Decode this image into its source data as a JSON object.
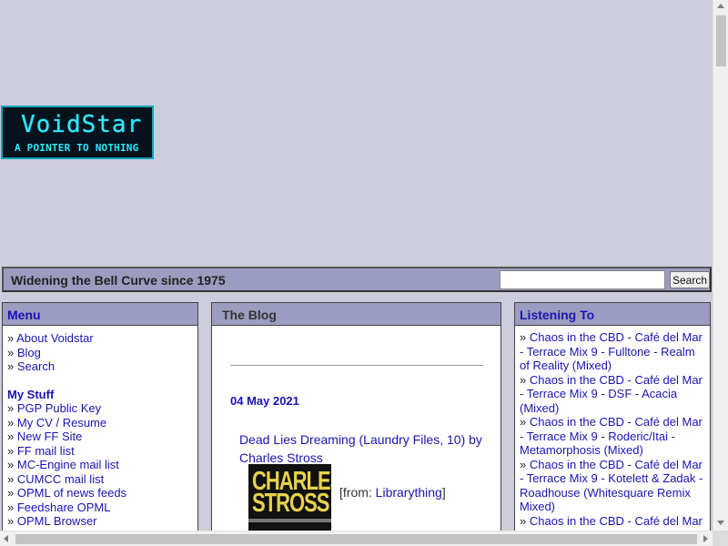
{
  "logo": {
    "title": "VoidStar",
    "subtitle": "A POINTER TO NOTHING"
  },
  "tagbar": {
    "tagline": "Widening the Bell Curve since 1975",
    "search_value": "",
    "search_button": "Search"
  },
  "menu": {
    "title": "Menu",
    "bullet": "»",
    "items": [
      "About Voidstar",
      "Blog",
      "Search"
    ],
    "stuff_heading": "My Stuff",
    "stuff_items": [
      "PGP Public Key",
      "My CV / Resume",
      "New FF Site",
      "FF mail list",
      "MC-Engine mail list",
      "CUMCC mail list",
      "OPML of news feeds",
      "Feedshare OPML",
      "OPML Browser"
    ]
  },
  "blog": {
    "title": "The Blog",
    "date": "04 May 2021",
    "post_title": "Dead Lies Dreaming (Laundry Files, 10) by Charles Stross",
    "cover_line1": "CHARLES",
    "cover_line2": "STROSS",
    "from_prefix": "[from: ",
    "from_link": "Librarything",
    "from_suffix": "]"
  },
  "listening": {
    "title": "Listening To",
    "bullet": "»",
    "items": [
      "Chaos in the CBD - Café del Mar - Terrace Mix 9 - Fulltone - Realm of Reality (Mixed)",
      "Chaos in the CBD - Café del Mar - Terrace Mix 9 - DSF - Acacia (Mixed)",
      "Chaos in the CBD - Café del Mar - Terrace Mix 9 - Roderic/Itai - Metamorphosis (Mixed)",
      "Chaos in the CBD - Café del Mar - Terrace Mix 9 - Kotelett & Zadak - Roadhouse (Whitesquare Remix Mixed)",
      "Chaos in the CBD - Café del Mar"
    ]
  },
  "colors": {
    "page_bg": "#ccccda",
    "header_bg": "#9c9cc0",
    "link": "#1a14b4",
    "logo_text": "#2ee8ff",
    "logo_bg": "#06121c"
  }
}
